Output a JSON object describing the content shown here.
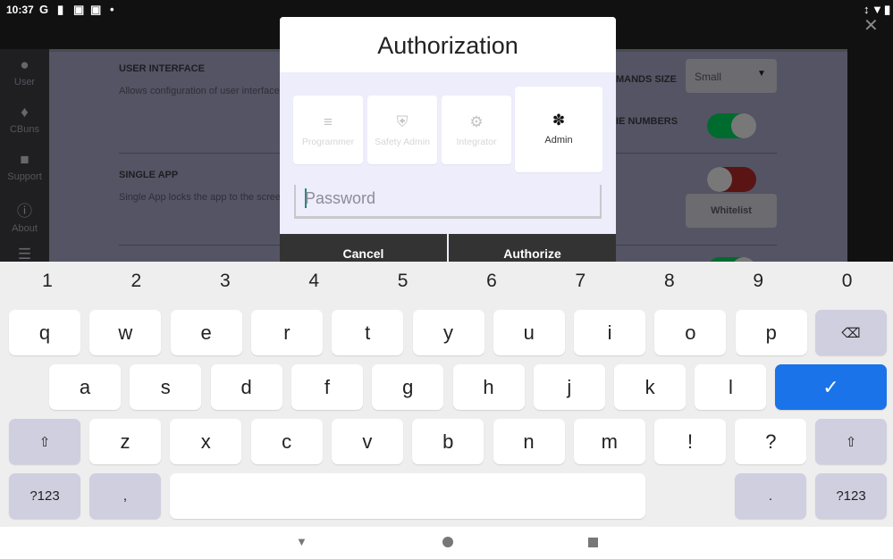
{
  "status_bar": {
    "time": "10:37",
    "icons": [
      "google-icon",
      "keyhole-icon",
      "teamviewer-icon",
      "teamviewer-icon",
      "dot-icon"
    ],
    "right_icons": [
      "data-arrows-icon",
      "wifi-icon",
      "battery-icon"
    ]
  },
  "sidebar": {
    "items": [
      {
        "label": "User",
        "icon": "person-icon"
      },
      {
        "label": "CBuns",
        "icon": "puzzle-icon"
      },
      {
        "label": "Support",
        "icon": "feedback-icon"
      },
      {
        "label": "About",
        "icon": "info-icon"
      },
      {
        "label": "",
        "icon": "list-icon"
      }
    ]
  },
  "content": {
    "user_interface": {
      "title": "USER INTERFACE",
      "description": "Allows configuration of user interface",
      "commands_size_label": "MANDS SIZE",
      "commands_size_value": "Small",
      "line_numbers_label": "IE NUMBERS",
      "line_numbers_on": true
    },
    "single_app": {
      "title": "SINGLE APP",
      "description": "Single App locks the app to the scree",
      "enabled": false,
      "whitelist_label": "Whitelist"
    },
    "next_toggle_on": true,
    "colors": {
      "toggle_on": "#006b2e",
      "toggle_off": "#5a1414"
    }
  },
  "dialog": {
    "title": "Authorization",
    "roles": [
      {
        "label": "Programmer",
        "icon": "notes-icon",
        "selected": false
      },
      {
        "label": "Safety Admin",
        "icon": "shield-icon",
        "selected": false
      },
      {
        "label": "Integrator",
        "icon": "gear-icon",
        "selected": false
      },
      {
        "label": "Admin",
        "icon": "bug-icon",
        "selected": true
      }
    ],
    "password_placeholder": "Password",
    "password_value": "",
    "cancel_label": "Cancel",
    "authorize_label": "Authorize"
  },
  "keyboard": {
    "numbers": [
      "1",
      "2",
      "3",
      "4",
      "5",
      "6",
      "7",
      "8",
      "9",
      "0"
    ],
    "row1": [
      "q",
      "w",
      "e",
      "r",
      "t",
      "y",
      "u",
      "i",
      "o",
      "p"
    ],
    "row2": [
      "a",
      "s",
      "d",
      "f",
      "g",
      "h",
      "j",
      "k",
      "l"
    ],
    "row3": [
      "z",
      "x",
      "c",
      "v",
      "b",
      "n",
      "m",
      "!",
      "?"
    ],
    "symbols_label": "?123",
    "comma": ",",
    "period": ".",
    "accent": "#1a73e8"
  },
  "nav": {
    "back": "back-icon",
    "home": "home-icon",
    "recents": "recents-icon"
  }
}
